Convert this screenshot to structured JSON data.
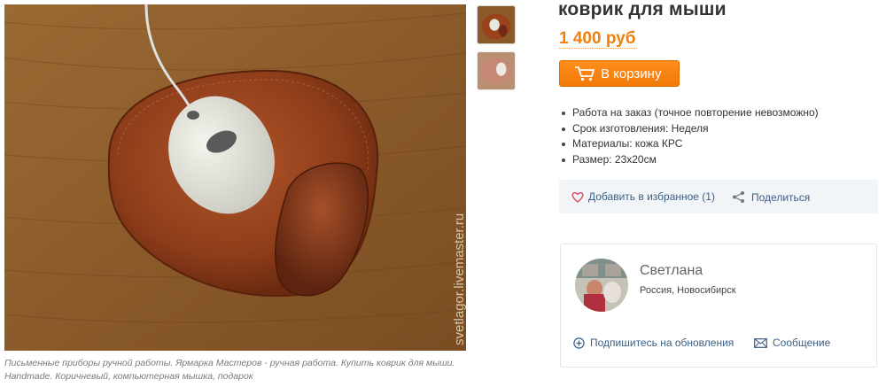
{
  "product": {
    "title": "коврик для мыши",
    "price": "1 400 руб",
    "cart_button": "В корзину",
    "watermark": "svetlagor.livemaster.ru",
    "features": [
      "Работа на заказ  (точное повторение невозможно)",
      "Срок изготовления: Неделя",
      "Материалы: кожа КРС",
      "Размер: 23х20см"
    ],
    "caption": "Письменные приборы ручной работы. Ярмарка Мастеров - ручная работа. Купить коврик для мыши. Handmade. Коричневый, компьютерная мышка, подарок"
  },
  "actions": {
    "favorite": "Добавить в избранное (1)",
    "share": "Поделиться"
  },
  "seller": {
    "name": "Светлана",
    "location": "Россия, Новосибирск",
    "subscribe": "Подпишитесь на обновления",
    "message": "Сообщение"
  },
  "icons": {
    "cart": "shopping-cart-icon",
    "favorite": "heart-icon",
    "share": "share-icon",
    "subscribe": "plus-circle-icon",
    "message": "envelope-icon"
  },
  "colors": {
    "accent": "#f0800d",
    "link": "#3b5f85",
    "button_bg": "#f7840f"
  }
}
